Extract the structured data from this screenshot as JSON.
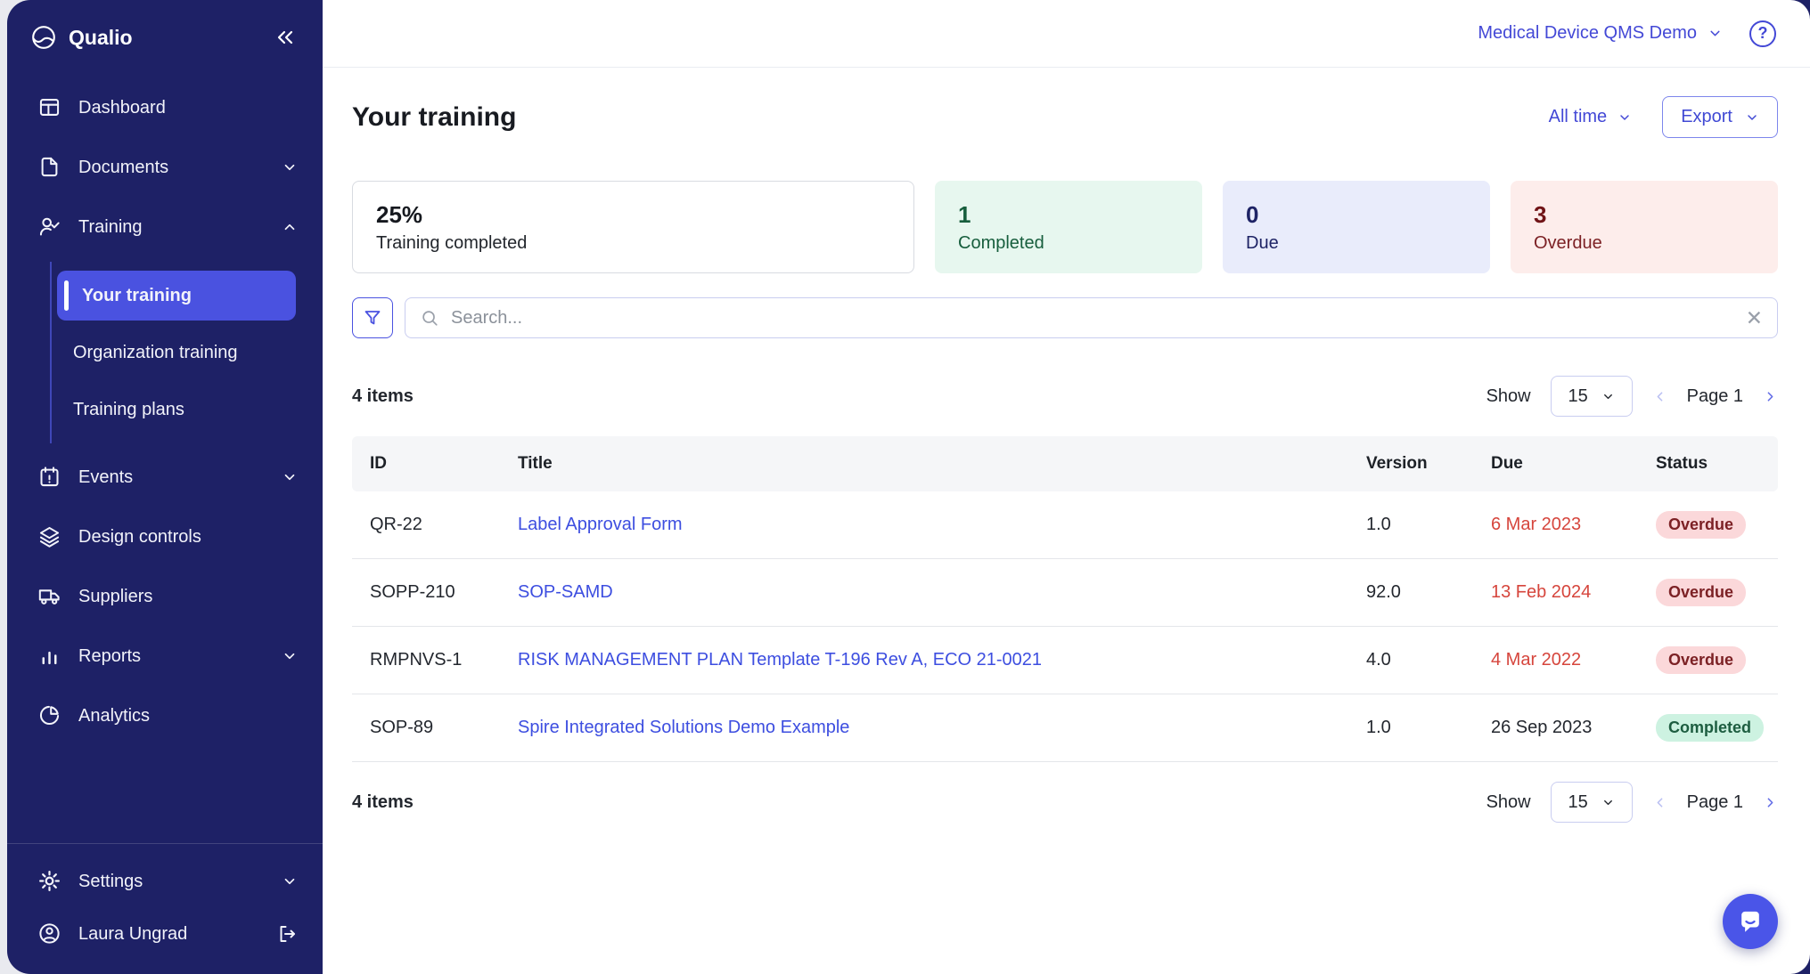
{
  "sidebar": {
    "logo_text": "Qualio",
    "dashboard": "Dashboard",
    "documents": "Documents",
    "training": "Training",
    "your_training": "Your training",
    "organization_training": "Organization training",
    "training_plans": "Training plans",
    "events": "Events",
    "design_controls": "Design controls",
    "suppliers": "Suppliers",
    "reports": "Reports",
    "analytics": "Analytics",
    "settings": "Settings",
    "user_name": "Laura Ungrad"
  },
  "topbar": {
    "org_name": "Medical Device QMS Demo"
  },
  "header": {
    "title": "Your training",
    "time_filter": "All time",
    "export_label": "Export"
  },
  "stats": {
    "percent": {
      "value": "25%",
      "label": "Training completed"
    },
    "completed": {
      "value": "1",
      "label": "Completed"
    },
    "due": {
      "value": "0",
      "label": "Due"
    },
    "overdue": {
      "value": "3",
      "label": "Overdue"
    }
  },
  "search": {
    "placeholder": "Search..."
  },
  "list": {
    "items_count": "4 items",
    "show_label": "Show",
    "page_size": "15",
    "page_label": "Page 1"
  },
  "table": {
    "columns": [
      "ID",
      "Title",
      "Version",
      "Due",
      "Status"
    ],
    "rows": [
      {
        "id": "QR-22",
        "title": "Label Approval Form",
        "version": "1.0",
        "due": "6 Mar 2023",
        "due_variant": "overdue",
        "status": "Overdue",
        "status_variant": "overdue"
      },
      {
        "id": "SOPP-210",
        "title": "SOP-SAMD",
        "version": "92.0",
        "due": "13 Feb 2024",
        "due_variant": "overdue",
        "status": "Overdue",
        "status_variant": "overdue"
      },
      {
        "id": "RMPNVS-1",
        "title": "RISK MANAGEMENT PLAN Template T-196 Rev A, ECO 21-0021",
        "version": "4.0",
        "due": "4 Mar 2022",
        "due_variant": "overdue",
        "status": "Overdue",
        "status_variant": "overdue"
      },
      {
        "id": "SOP-89",
        "title": "Spire Integrated Solutions Demo Example",
        "version": "1.0",
        "due": "26 Sep 2023",
        "due_variant": "normal",
        "status": "Completed",
        "status_variant": "completed"
      }
    ]
  },
  "icons": {
    "help_glyph": "?",
    "clear_glyph": "✕"
  },
  "colors": {
    "sidebar_bg": "#1e2166",
    "accent_indigo": "#4a52e0",
    "link_indigo": "#3d4ee0",
    "overdue_date": "#d6453c",
    "overdue_pill_bg": "#fbd8da",
    "overdue_pill_text": "#7c2125",
    "completed_pill_bg": "#cdf2e1",
    "completed_pill_text": "#1d5d40",
    "completed_card_bg": "#e7f7ef",
    "due_card_bg": "#e9ecfb",
    "overdue_card_bg": "#fdedeb"
  }
}
